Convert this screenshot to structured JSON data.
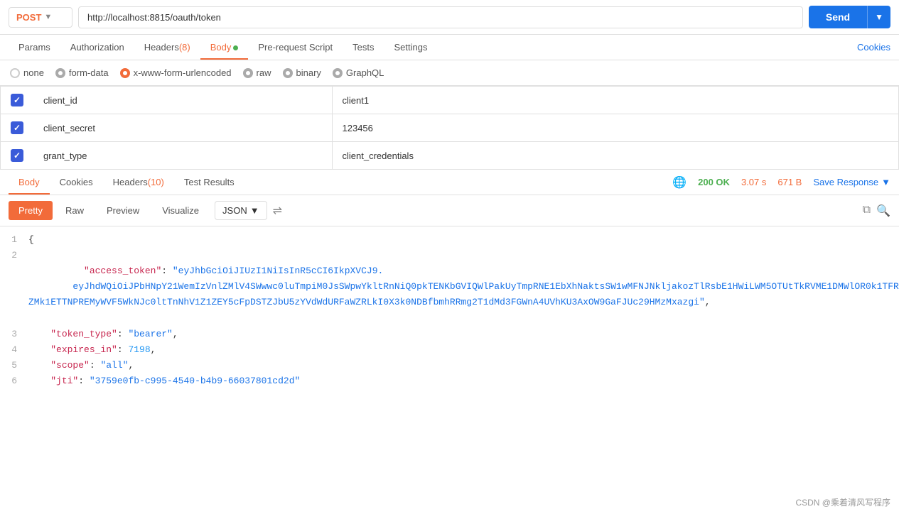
{
  "topbar": {
    "method": "POST",
    "url": "http://localhost:8815/oauth/token",
    "send_label": "Send",
    "send_dropdown_icon": "▼"
  },
  "tabs": {
    "items": [
      {
        "id": "params",
        "label": "Params",
        "active": false,
        "badge": null,
        "dot": false
      },
      {
        "id": "authorization",
        "label": "Authorization",
        "active": false,
        "badge": null,
        "dot": false
      },
      {
        "id": "headers",
        "label": "Headers",
        "active": false,
        "badge": "(8)",
        "dot": false
      },
      {
        "id": "body",
        "label": "Body",
        "active": true,
        "badge": null,
        "dot": true
      },
      {
        "id": "prerequest",
        "label": "Pre-request Script",
        "active": false,
        "badge": null,
        "dot": false
      },
      {
        "id": "tests",
        "label": "Tests",
        "active": false,
        "badge": null,
        "dot": false
      },
      {
        "id": "settings",
        "label": "Settings",
        "active": false,
        "badge": null,
        "dot": false
      }
    ],
    "cookies_label": "Cookies"
  },
  "body_types": [
    {
      "id": "none",
      "label": "none",
      "checked": false,
      "color": "gray"
    },
    {
      "id": "form-data",
      "label": "form-data",
      "checked": false,
      "color": "gray"
    },
    {
      "id": "x-www-form-urlencoded",
      "label": "x-www-form-urlencoded",
      "checked": true,
      "color": "orange"
    },
    {
      "id": "raw",
      "label": "raw",
      "checked": false,
      "color": "gray"
    },
    {
      "id": "binary",
      "label": "binary",
      "checked": false,
      "color": "gray"
    },
    {
      "id": "graphql",
      "label": "GraphQL",
      "checked": false,
      "color": "gray"
    }
  ],
  "form_rows": [
    {
      "checked": true,
      "key": "client_id",
      "value": "client1"
    },
    {
      "checked": true,
      "key": "client_secret",
      "value": "123456"
    },
    {
      "checked": true,
      "key": "grant_type",
      "value": "client_credentials"
    }
  ],
  "response": {
    "tabs": [
      {
        "id": "body",
        "label": "Body",
        "active": true,
        "badge": null
      },
      {
        "id": "cookies",
        "label": "Cookies",
        "active": false,
        "badge": null
      },
      {
        "id": "headers",
        "label": "Headers",
        "active": false,
        "badge": "(10)"
      },
      {
        "id": "test-results",
        "label": "Test Results",
        "active": false,
        "badge": null
      }
    ],
    "status": "200 OK",
    "time": "3.07 s",
    "size": "671 B",
    "save_response_label": "Save Response",
    "format_tabs": [
      "Pretty",
      "Raw",
      "Preview",
      "Visualize"
    ],
    "active_format": "Pretty",
    "json_format": "JSON",
    "lines": [
      {
        "num": 1,
        "content": "{"
      },
      {
        "num": 2,
        "key": "access_token",
        "value": "\"eyJhbGciOiJIUzI1NiIsInR5cCI6IkpXVCJ9.eyJhdWQiOiJPbHNpY21WemIzVnlZMlV4SWwwc0luTmpiM0JsSWpwYkltRnNiQ0pkTENKbGVIQWlPakUyTmpRNE1EbXhNaktsSW1wMFNJNkljakozTlRsbE1HWiLWM5OTUtTkRVME1DMWlOR0k1TFRZMk1ETTNPREMyWVF5WkNJc0ltTnNhV1Z1ZEY5cFpDSTZJbU5zYVdWdURFaWZRLkI0X3k0NDBfbmhRRmg2T1dMd3FGWnA4UVhKU3AxOW9GaFJUc29HMzMxazgi\"",
        "comma": ","
      },
      {
        "num": 3,
        "key": "token_type",
        "value": "\"bearer\"",
        "comma": ","
      },
      {
        "num": 4,
        "key": "expires_in",
        "value": "7198",
        "comma": ","
      },
      {
        "num": 5,
        "key": "scope",
        "value": "\"all\"",
        "comma": ","
      },
      {
        "num": 6,
        "key": "jti",
        "value": "\"3759e0fb-c995-4540-b4b9-66037801cd2d\"",
        "comma": ""
      }
    ],
    "line7": "}"
  },
  "watermark": "CSDN @乘着清风写程序"
}
